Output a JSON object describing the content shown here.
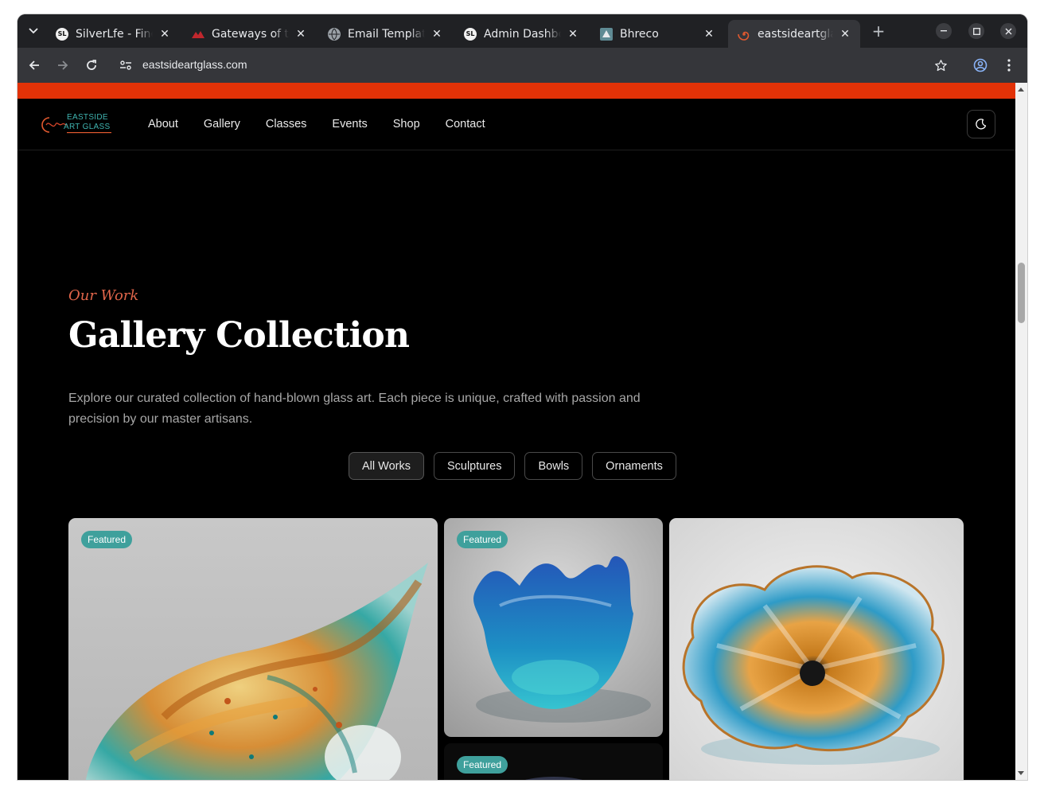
{
  "browser": {
    "tabs": [
      {
        "title": "SilverLfe - Find",
        "favicon": "SL"
      },
      {
        "title": "Gateways of the",
        "favicon": "globe-red"
      },
      {
        "title": "Email Template",
        "favicon": "globe"
      },
      {
        "title": "Admin Dashboard",
        "favicon": "SL"
      },
      {
        "title": "Bhreco",
        "favicon": "A"
      },
      {
        "title": "eastsideartglass",
        "favicon": "spiral"
      }
    ],
    "url": "eastsideartglass.com"
  },
  "site": {
    "logo": {
      "line1": "EASTSIDE",
      "line2": "ART GLASS"
    },
    "nav": [
      "About",
      "Gallery",
      "Classes",
      "Events",
      "Shop",
      "Contact"
    ],
    "colors": {
      "topbar": "#e23207",
      "accent": "#3fa09c",
      "eyebrow": "#e0654a"
    }
  },
  "hero": {
    "eyebrow": "Our Work",
    "title": "Gallery Collection",
    "description": "Explore our curated collection of hand-blown glass art. Each piece is unique, crafted with passion and precision by our master artisans."
  },
  "filters": [
    "All Works",
    "Sculptures",
    "Bowls",
    "Ornaments"
  ],
  "gallery": {
    "badge": "Featured"
  }
}
